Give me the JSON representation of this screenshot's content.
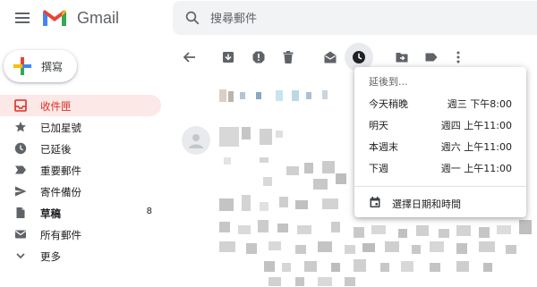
{
  "header": {
    "brand": "Gmail",
    "search_placeholder": "搜尋郵件",
    "colors": {
      "red": "#ea4335",
      "blue": "#4285f4",
      "green": "#34a853",
      "yellow": "#fbbc04"
    }
  },
  "compose": {
    "label": "撰寫"
  },
  "sidebar": {
    "items": [
      {
        "label": "收件匣",
        "icon": "inbox-icon",
        "active": true,
        "count": ""
      },
      {
        "label": "已加星號",
        "icon": "star-icon",
        "count": ""
      },
      {
        "label": "已延後",
        "icon": "clock-icon",
        "count": ""
      },
      {
        "label": "重要郵件",
        "icon": "important-label-icon",
        "count": ""
      },
      {
        "label": "寄件備份",
        "icon": "send-icon",
        "count": ""
      },
      {
        "label": "草稿",
        "icon": "draft-file-icon",
        "count": "8"
      },
      {
        "label": "所有郵件",
        "icon": "mail-icon",
        "count": ""
      },
      {
        "label": "更多",
        "icon": "chevron-down-icon",
        "count": ""
      }
    ]
  },
  "toolbar": {
    "buttons": [
      "back-arrow-icon",
      "archive-icon",
      "report-spam-icon",
      "delete-icon",
      "mark-unread-icon",
      "snooze-clock-icon",
      "move-to-icon",
      "label-icon",
      "more-vert-icon"
    ],
    "active": "snooze-clock-icon"
  },
  "snooze_menu": {
    "title": "延後到...",
    "options": [
      {
        "label": "今天稍晚",
        "time": "週三 下午8:00"
      },
      {
        "label": "明天",
        "time": "週四 上午11:00"
      },
      {
        "label": "本週末",
        "time": "週六 上午11:00"
      },
      {
        "label": "下週",
        "time": "週一 上午11:00"
      }
    ],
    "pick_label": "選擇日期和時間"
  }
}
